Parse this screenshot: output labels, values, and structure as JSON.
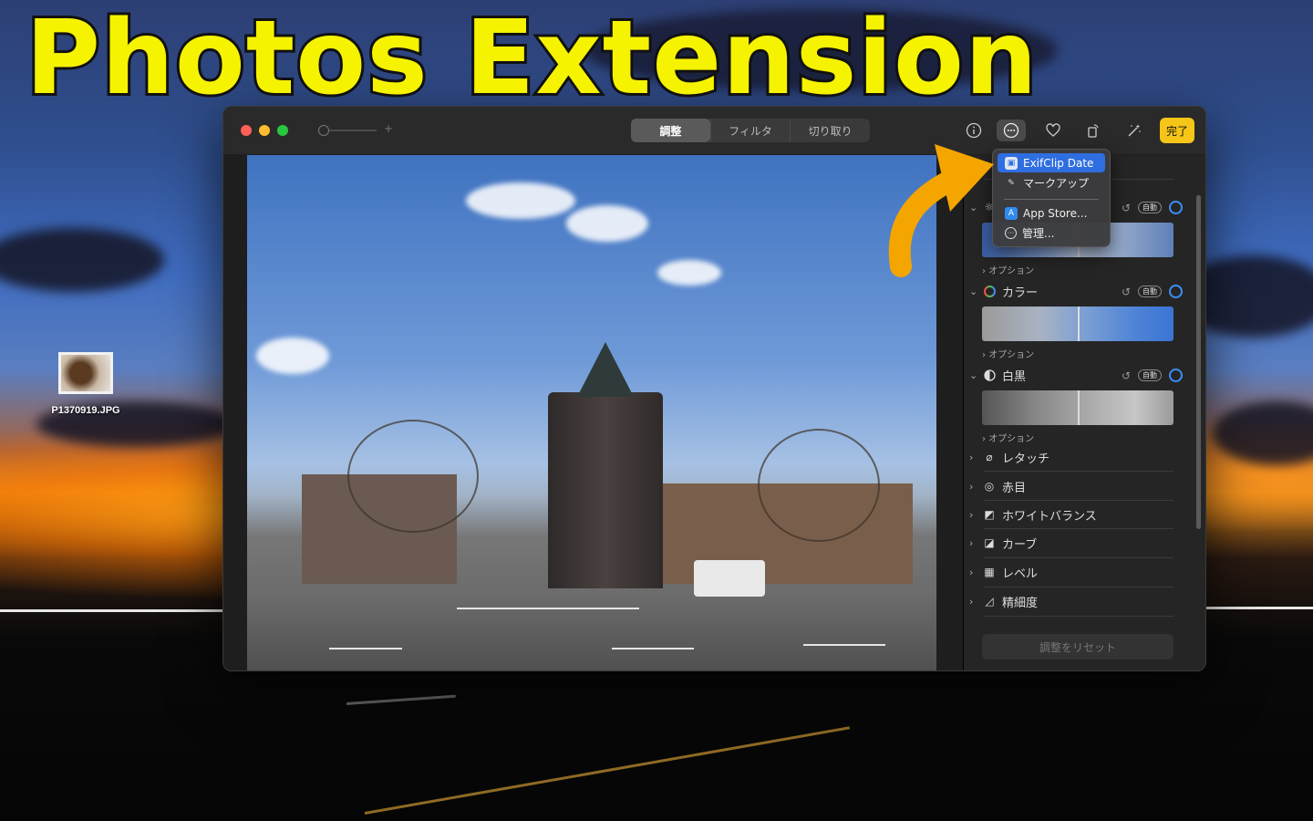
{
  "banner": {
    "title": "Photos Extension"
  },
  "desktop": {
    "file": {
      "name": "P1370919.JPG"
    }
  },
  "window": {
    "tabs": [
      {
        "label": "調整",
        "selected": true
      },
      {
        "label": "フィルタ",
        "selected": false
      },
      {
        "label": "切り取り",
        "selected": false
      }
    ],
    "toolbar_icons": [
      "info-icon",
      "more-extensions-icon",
      "favorite-heart-icon",
      "rotate-icon",
      "auto-enhance-icon"
    ],
    "done_label": "完了",
    "zoom_plus": "+"
  },
  "extensions_menu": {
    "items": [
      {
        "label": "ExifClip Date",
        "icon": "exifclip-app-icon",
        "highlighted": true
      },
      {
        "label": "マークアップ",
        "icon": "markup-icon",
        "highlighted": false
      },
      {
        "label": "App Store...",
        "icon": "app-store-icon",
        "highlighted": false
      },
      {
        "label": "管理...",
        "icon": "more-icon",
        "highlighted": false
      }
    ]
  },
  "adjust_panel": {
    "sections": [
      {
        "label": "カラー",
        "auto": "自動",
        "options": "オプション"
      },
      {
        "label": "白黒",
        "auto": "自動",
        "options": "オプション"
      }
    ],
    "light_options": "オプション",
    "light_auto": "自動",
    "collapsed": [
      "レタッチ",
      "赤目",
      "ホワイトバランス",
      "カーブ",
      "レベル",
      "精細度"
    ],
    "reset_label": "調整をリセット"
  },
  "colors": {
    "accent": "#2f6ee0",
    "done": "#f5c518",
    "banner_text": "#f6f300",
    "arrow": "#f5a500"
  }
}
